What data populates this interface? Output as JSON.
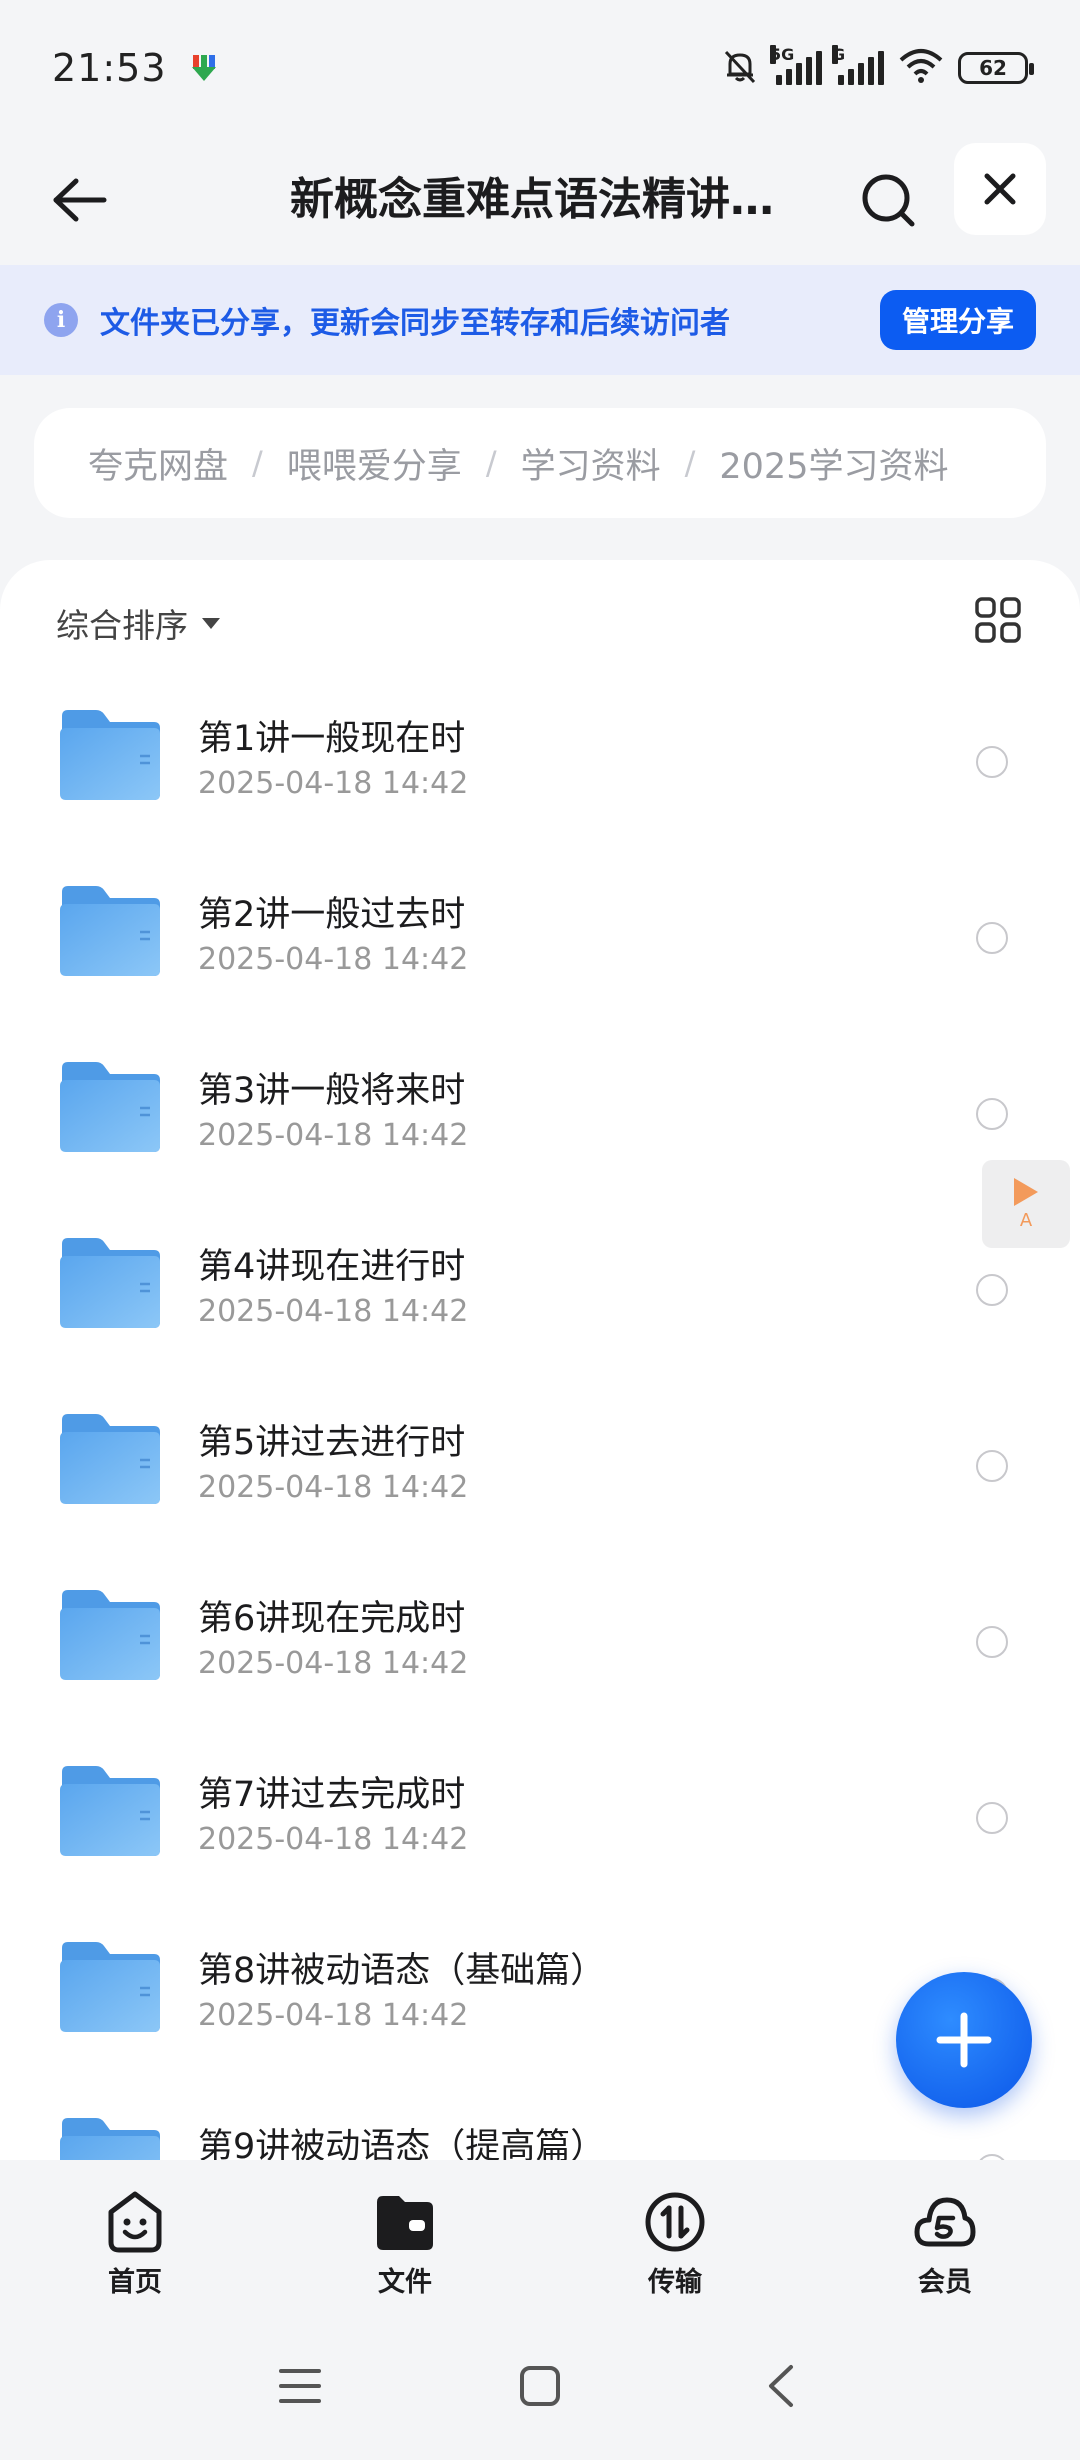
{
  "status_bar": {
    "time": "21:53",
    "network_1": "5G",
    "network_2": "G",
    "battery": "62",
    "icons": [
      "download-app-icon",
      "bell-muted-icon",
      "signal-icon",
      "wifi-icon",
      "battery-icon"
    ]
  },
  "header": {
    "title": "新概念重难点语法精讲…",
    "back_icon": "arrow-left-icon",
    "search_icon": "search-icon",
    "close_icon": "close-icon"
  },
  "share_banner": {
    "text": "文件夹已分享，更新会同步至转存和后续访问者",
    "button": "管理分享",
    "icon": "info-icon"
  },
  "breadcrumb": {
    "items": [
      "夸克网盘",
      "喂喂爱分享",
      "学习资料",
      "2025学习资料"
    ]
  },
  "toolbar": {
    "sort_label": "综合排序",
    "view_toggle_icon": "grid-view-icon"
  },
  "files": [
    {
      "name": "第1讲一般现在时",
      "date": "2025-04-18 14:42"
    },
    {
      "name": "第2讲一般过去时",
      "date": "2025-04-18 14:42"
    },
    {
      "name": "第3讲一般将来时",
      "date": "2025-04-18 14:42"
    },
    {
      "name": "第4讲现在进行时",
      "date": "2025-04-18 14:42"
    },
    {
      "name": "第5讲过去进行时",
      "date": "2025-04-18 14:42"
    },
    {
      "name": "第6讲现在完成时",
      "date": "2025-04-18 14:42"
    },
    {
      "name": "第7讲过去完成时",
      "date": "2025-04-18 14:42"
    },
    {
      "name": "第8讲被动语态（基础篇）",
      "date": "2025-04-18 14:42"
    },
    {
      "name": "第9讲被动语态（提高篇）",
      "date": ""
    }
  ],
  "float_player": {
    "label": "A"
  },
  "bottom_nav": {
    "items": [
      {
        "label": "首页",
        "icon": "home-smile-icon"
      },
      {
        "label": "文件",
        "icon": "folder-icon"
      },
      {
        "label": "传输",
        "icon": "transfer-icon"
      },
      {
        "label": "会员",
        "icon": "member-cloud-icon"
      }
    ]
  },
  "colors": {
    "accent": "#0c5cf2",
    "banner_bg": "#e8ecfb",
    "banner_text": "#1d5be6",
    "folder": "#6db3f2",
    "player": "#f39a5b"
  }
}
